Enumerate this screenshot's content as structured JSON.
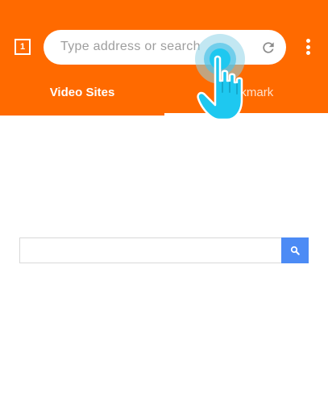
{
  "header": {
    "tab_count": "1",
    "address_placeholder": "Type address or search"
  },
  "tabs": [
    {
      "label": "Video Sites",
      "selected": false
    },
    {
      "label": "Bookmark",
      "selected": true
    }
  ],
  "search": {
    "query": "",
    "button_icon": "search-icon"
  },
  "colors": {
    "brand": "#ff6a00",
    "search_button": "#4c8bf5",
    "touch_hint": "#1ec8f0"
  },
  "overlay": {
    "icon": "hand-pointer-icon"
  }
}
